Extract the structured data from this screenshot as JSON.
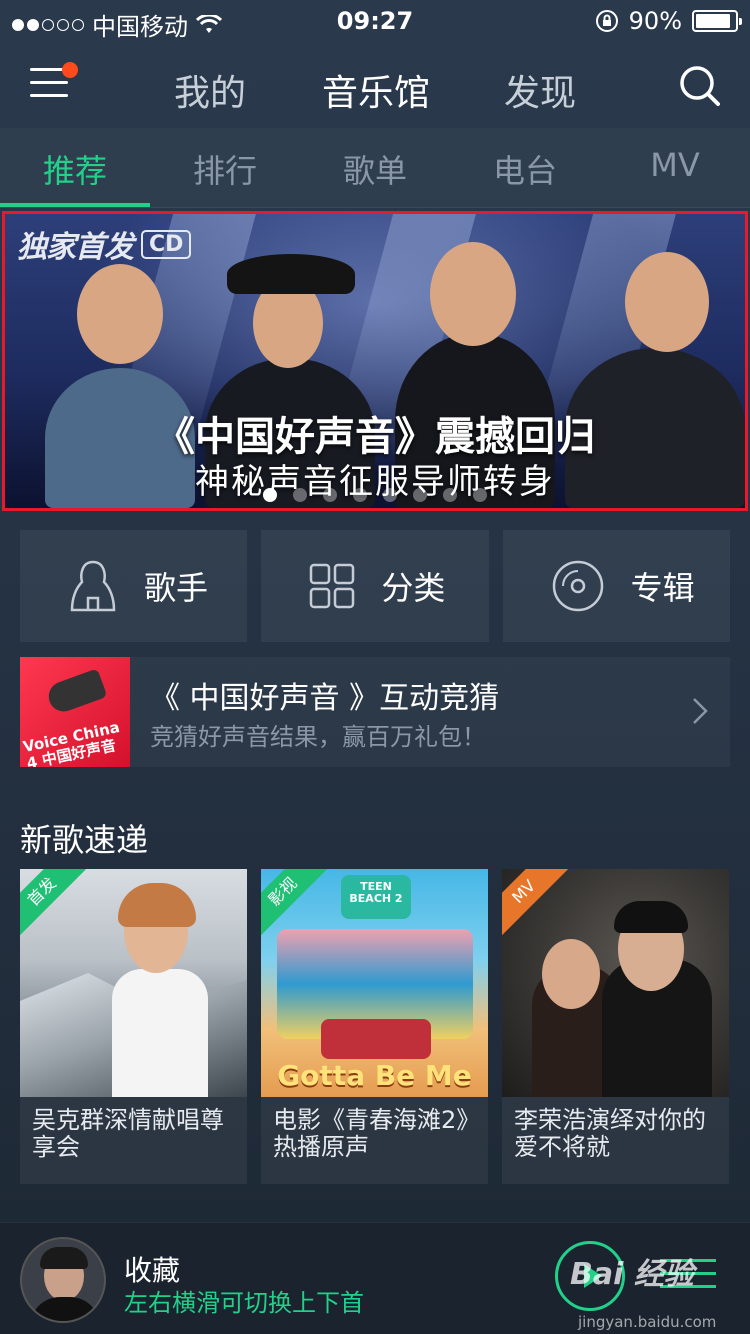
{
  "status": {
    "carrier": "中国移动",
    "time": "09:27",
    "battery_text": "90%",
    "battery_level": 0.9,
    "signal_bars_filled": 2,
    "signal_bars_total": 5
  },
  "nav": {
    "tabs": [
      "我的",
      "音乐馆",
      "发现"
    ],
    "active_tab": "音乐馆"
  },
  "subtabs": {
    "items": [
      "推荐",
      "排行",
      "歌单",
      "电台",
      "MV"
    ],
    "active": "推荐"
  },
  "banner": {
    "tag": "独家首发",
    "tag_badge": "CD",
    "title": "《中国好声音》震撼回归",
    "subtitle": "神秘声音征服导师转身",
    "page_count": 8,
    "active_page": 1
  },
  "categories": [
    {
      "label": "歌手",
      "icon": "singer-icon"
    },
    {
      "label": "分类",
      "icon": "grid-icon"
    },
    {
      "label": "专辑",
      "icon": "disc-icon"
    }
  ],
  "promo": {
    "title": "《 中国好声音 》互动竞猜",
    "subtitle": "竞猜好声音结果，赢百万礼包！",
    "thumb_text": "Voice China 4 中国好声音"
  },
  "section": {
    "title": "新歌速递"
  },
  "cards": [
    {
      "badge": "首发",
      "caption": "吴克群深情献唱尊享会",
      "badge_color": "#1fbf74"
    },
    {
      "badge": "影视",
      "caption": "电影《青春海滩2》热播原声",
      "badge_color": "#1fbf74",
      "poster_text": "Gotta Be Me",
      "poster_top": "TEEN BEACH 2"
    },
    {
      "badge": "MV",
      "caption": "李荣浩演绎对你的爱不将就",
      "badge_color": "#e8762a"
    }
  ],
  "player": {
    "title": "收藏",
    "hint": "左右横滑可切换上下首"
  },
  "watermark": {
    "brand": "Bai 经验",
    "url": "jingyan.baidu.com"
  },
  "colors": {
    "accent": "#22d08a",
    "highlight_border": "#e8192c",
    "badge_dot": "#ff4a1c"
  }
}
